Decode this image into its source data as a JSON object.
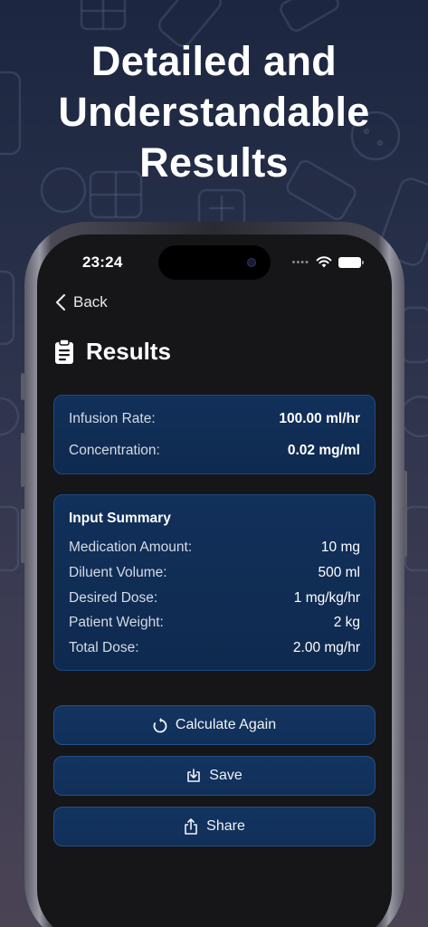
{
  "headline": [
    "Detailed and",
    "Understandable",
    "Results"
  ],
  "status_bar": {
    "time": "23:24",
    "signal_dots": "••••"
  },
  "nav": {
    "back_label": "Back"
  },
  "page": {
    "title": "Results"
  },
  "results": {
    "items": [
      {
        "label": "Infusion Rate:",
        "value": "100.00 ml/hr"
      },
      {
        "label": "Concentration:",
        "value": "0.02 mg/ml"
      }
    ]
  },
  "input_summary": {
    "title": "Input Summary",
    "items": [
      {
        "label": "Medication Amount:",
        "value": "10 mg"
      },
      {
        "label": "Diluent Volume:",
        "value": "500 ml"
      },
      {
        "label": "Desired Dose:",
        "value": "1 mg/kg/hr"
      },
      {
        "label": "Patient Weight:",
        "value": "2 kg"
      },
      {
        "label": "Total Dose:",
        "value": "2.00 mg/hr"
      }
    ]
  },
  "actions": {
    "calculate_again": "Calculate Again",
    "save": "Save",
    "share": "Share"
  },
  "icons": {
    "back": "chevron-left-icon",
    "title": "clipboard-icon",
    "calculate_again": "refresh-icon",
    "save": "download-tray-icon",
    "share": "share-icon",
    "status": [
      "wifi-icon",
      "battery-icon"
    ]
  },
  "colors": {
    "screen_background": "#161618",
    "card_background": "#11305a",
    "card_border": "#1e4a82",
    "button_background": "#13345f"
  }
}
